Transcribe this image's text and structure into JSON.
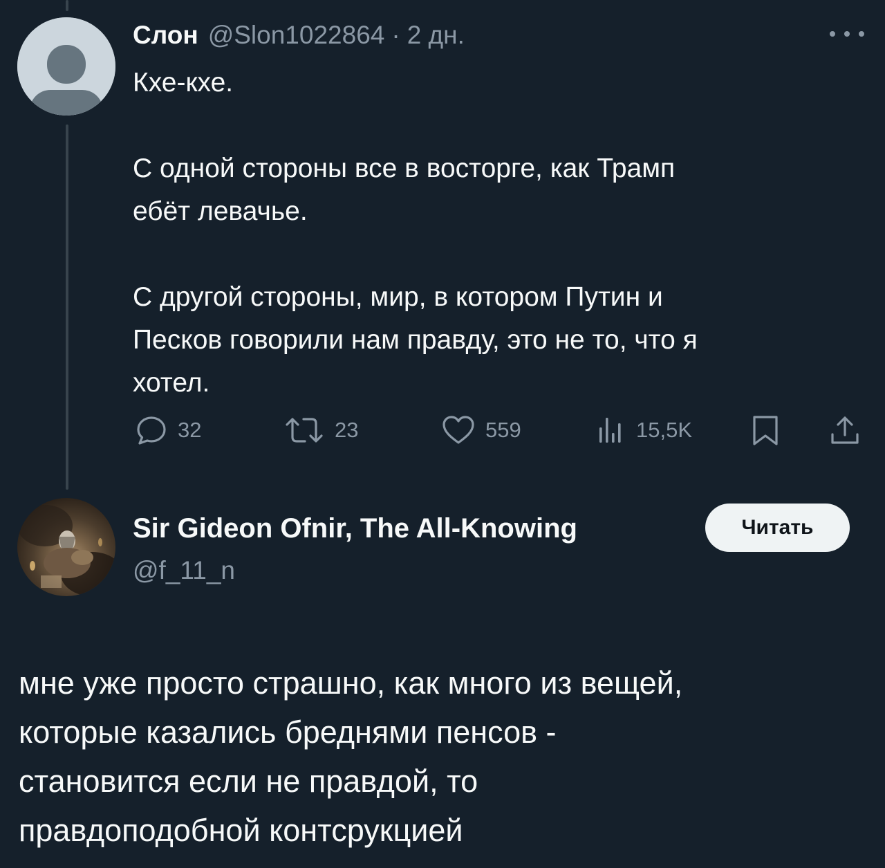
{
  "tweet": {
    "author_name": "Слон",
    "handle": "@Slon1022864",
    "separator": "·",
    "time": "2 дн.",
    "lines": [
      "Кхе-кхе.",
      "",
      "С одной стороны все в восторге, как Трамп",
      "ебёт левачье.",
      "",
      "С другой стороны, мир, в котором Путин и",
      "Песков говорили нам правду, это не то, что я",
      "хотел."
    ],
    "stats": {
      "replies": "32",
      "retweets": "23",
      "likes": "559",
      "views": "15,5K"
    }
  },
  "reply": {
    "author_name": "Sir Gideon Ofnir, The All-Knowing",
    "handle": "@f_11_n",
    "follow_label": "Читать",
    "lines": [
      "мне уже просто страшно, как много из вещей,",
      "которые казались бреднями пенсов -",
      "становится если не правдой, то",
      "правдоподобной контсрукцией"
    ]
  },
  "icons": {
    "reply": "comment-icon",
    "retweet": "retweet-icon",
    "like": "heart-icon",
    "views": "analytics-icon",
    "bookmark": "bookmark-icon",
    "share": "share-icon",
    "more": "more-icon"
  },
  "colors": {
    "background": "#15202b",
    "text": "#f7f9f9",
    "secondary": "#8b98a5",
    "thread_line": "#38444d",
    "button_bg": "#eff3f4"
  }
}
